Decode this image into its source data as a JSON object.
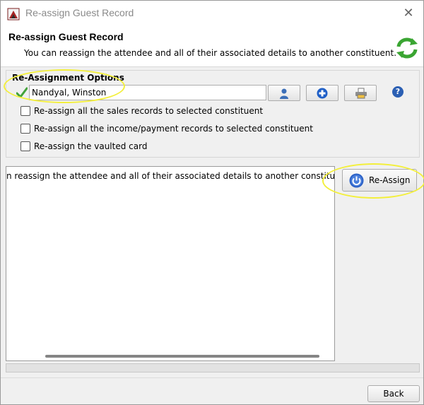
{
  "window": {
    "title": "Re-assign Guest Record",
    "close_glyph": "✕"
  },
  "header": {
    "title": "Re-assign Guest Record",
    "description": "You can reassign the attendee and all of their associated details to another constituent."
  },
  "options": {
    "legend": "Re-Assignment Options",
    "constituent_value": "Nandyal, Winston",
    "help_glyph": "?",
    "checkboxes": [
      {
        "label": "Re-assign all the sales records to selected constituent",
        "checked": false
      },
      {
        "label": "Re-assign all the income/payment records to selected constituent",
        "checked": false
      },
      {
        "label": "Re-assign the vaulted card",
        "checked": false
      }
    ]
  },
  "log": {
    "text": "n reassign the attendee and all of their associated details to another constituent."
  },
  "actions": {
    "reassign_label": "Re-Assign",
    "back_label": "Back"
  },
  "icons": {
    "app": "app-icon",
    "refresh": "refresh-icon",
    "valid": "checkmark-icon",
    "person": "person-icon",
    "add": "add-icon",
    "printer": "printer-icon",
    "help": "help-icon",
    "power": "power-icon",
    "close": "close-icon"
  },
  "colors": {
    "highlight": "#f3ef3b",
    "refresh_green": "#3aa532",
    "accent_blue": "#2b5fb3"
  }
}
